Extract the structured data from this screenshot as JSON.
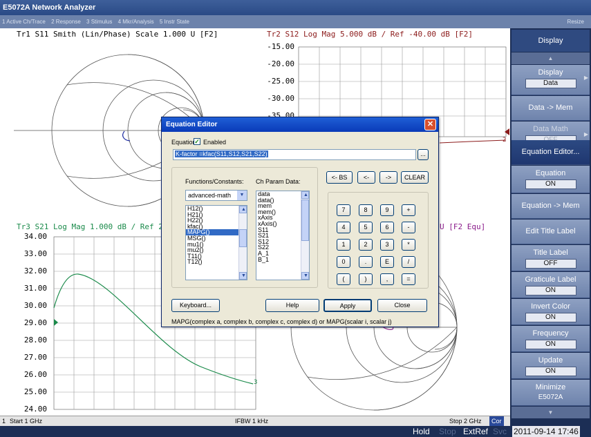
{
  "window": {
    "title": "E5072A Network Analyzer"
  },
  "menubar": {
    "items": [
      "1 Active Ch/Trace",
      "2 Response",
      "3 Stimulus",
      "4 Mkr/Analysis",
      "5 Instr State"
    ],
    "resize": "Resize"
  },
  "traces": {
    "tr1": {
      "title": "Tr1 S11 Smith (Lin/Phase) Scale 1.000 U [F2]",
      "color": "#000000"
    },
    "tr2": {
      "title": "Tr2 S12 Log Mag 5.000 dB / Ref -40.00 dB [F2]",
      "color": "#8b1a1a",
      "ticks": [
        "-15.00",
        "-20.00",
        "-25.00",
        "-30.00",
        "-35.00"
      ],
      "end_label": "2"
    },
    "tr3": {
      "title": "Tr3 S21 Log Mag 1.000 dB / Ref 2",
      "color": "#1a8a4a",
      "ticks": [
        "34.00",
        "33.00",
        "32.00",
        "31.00",
        "30.00",
        "29.00",
        "28.00",
        "27.00",
        "26.00",
        "25.00",
        "24.00"
      ],
      "end_label": "3"
    },
    "tr4": {
      "title_tail": "U [F2 Equ]",
      "color": "#8a1a8a"
    }
  },
  "statusbar": {
    "channel": "1",
    "start": "Start 1 GHz",
    "ifbw": "IFBW 1 kHz",
    "stop": "Stop 2 GHz",
    "cor": "Cor"
  },
  "bottombar": {
    "hold": "Hold",
    "stop": "Stop",
    "extref": "ExtRef",
    "svc": "Svc",
    "datetime": "2011-09-14 17:46"
  },
  "softmenu": {
    "header": "Display",
    "keys": [
      {
        "label": "Display",
        "value": "Data"
      },
      {
        "label": "Data -> Mem"
      },
      {
        "label": "Data Math",
        "value": "OFF"
      },
      {
        "label": "Equation Editor..."
      },
      {
        "label": "Equation",
        "value": "ON"
      },
      {
        "label": "Equation -> Mem"
      },
      {
        "label": "Edit Title Label"
      },
      {
        "label": "Title Label",
        "value": "OFF"
      },
      {
        "label": "Graticule Label",
        "value": "ON"
      },
      {
        "label": "Invert Color",
        "value": "ON"
      },
      {
        "label": "Frequency",
        "value": "ON"
      },
      {
        "label": "Update",
        "value": "ON"
      },
      {
        "label": "Minimize",
        "value": "E5072A"
      }
    ]
  },
  "dialog": {
    "title": "Equation Editor",
    "equation_label": "Equation:",
    "enabled_label": "Enabled",
    "equation_value": "K-factor =kfac(S11,S12,S21,S22)",
    "browse": "...",
    "functions_label": "Functions/Constants:",
    "chparam_label": "Ch Param Data:",
    "category": "advanced-math",
    "functions": [
      "H12()",
      "H21()",
      "H22()",
      "kfac()",
      "MAPG()",
      "MSG()",
      "mu1()",
      "mu2()",
      "T11()",
      "T12()"
    ],
    "selected_function": "MAPG()",
    "chparams": [
      "data",
      "data()",
      "mem",
      "mem()",
      "xAxis",
      "xAxis()",
      "S11",
      "S21",
      "S12",
      "S22",
      "A_1",
      "B_1"
    ],
    "editkeys": [
      "<- BS",
      "<-",
      "->",
      "CLEAR"
    ],
    "keypad": [
      [
        "7",
        "8",
        "9",
        "+"
      ],
      [
        "4",
        "5",
        "6",
        "-"
      ],
      [
        "1",
        "2",
        "3",
        "*"
      ],
      [
        "0",
        ".",
        "E",
        "/"
      ],
      [
        "(",
        ")",
        ",",
        "="
      ]
    ],
    "keyboard": "Keyboard...",
    "help": "Help",
    "apply": "Apply",
    "close": "Close",
    "hint": "MAPG(complex a, complex b, complex c, complex d) or MAPG(scalar i, scalar j)"
  }
}
